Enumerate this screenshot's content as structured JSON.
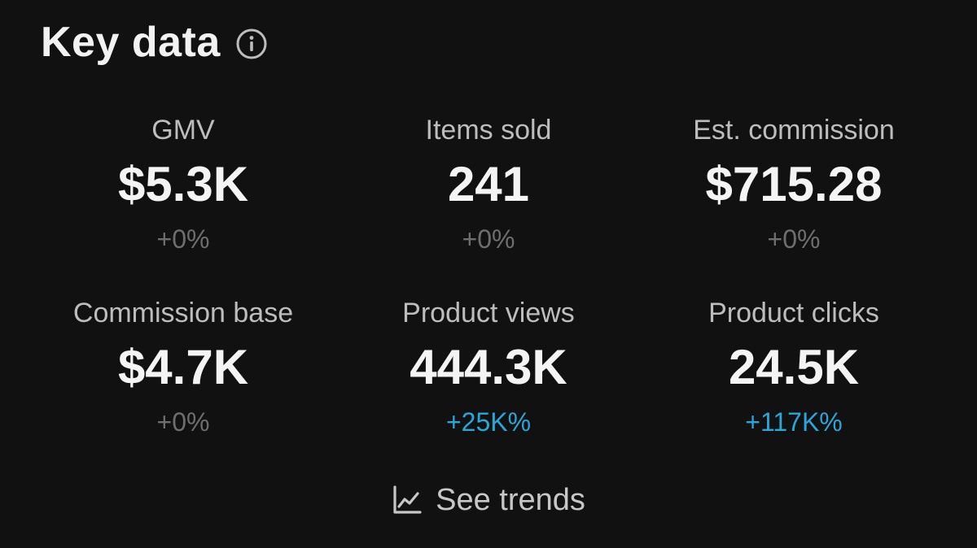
{
  "header": {
    "title": "Key data",
    "info_icon": "info-icon"
  },
  "metrics": [
    {
      "label": "GMV",
      "value": "$5.3K",
      "change": "+0%",
      "trend": "neutral"
    },
    {
      "label": "Items sold",
      "value": "241",
      "change": "+0%",
      "trend": "neutral"
    },
    {
      "label": "Est. commission",
      "value": "$715.28",
      "change": "+0%",
      "trend": "neutral"
    },
    {
      "label": "Commission base",
      "value": "$4.7K",
      "change": "+0%",
      "trend": "neutral"
    },
    {
      "label": "Product views",
      "value": "444.3K",
      "change": "+25K%",
      "trend": "up"
    },
    {
      "label": "Product clicks",
      "value": "24.5K",
      "change": "+117K%",
      "trend": "up"
    }
  ],
  "trends_button": {
    "label": "See trends",
    "icon": "line-chart-icon"
  },
  "colors": {
    "background": "#111111",
    "text_primary": "#f2f2f2",
    "text_secondary": "#bdbdbd",
    "change_neutral": "#6e6e6e",
    "change_up": "#2aa6d8"
  }
}
